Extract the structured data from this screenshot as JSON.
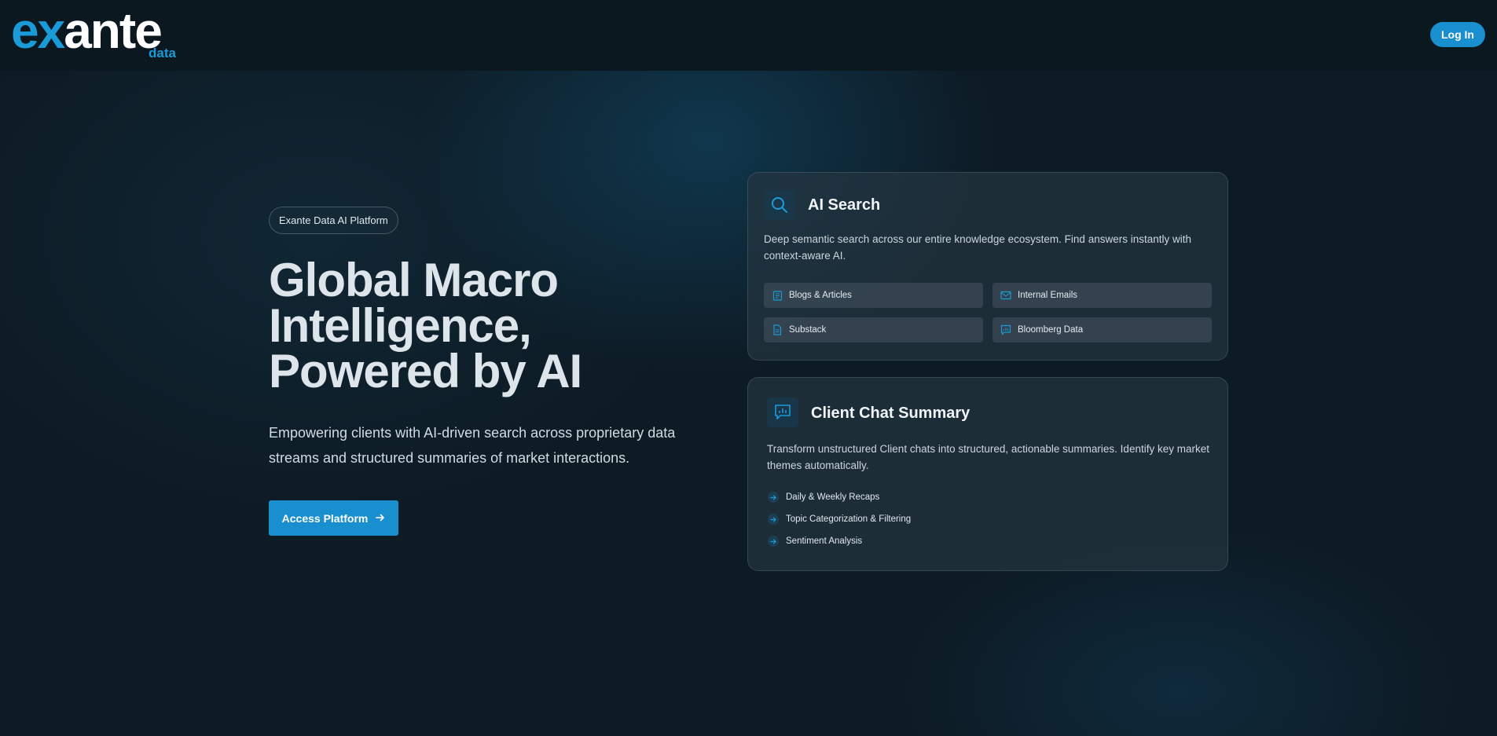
{
  "header": {
    "logo_main_a": "ex",
    "logo_main_b": "ante",
    "logo_sub": "data",
    "login_label": "Log In"
  },
  "hero": {
    "badge": "Exante Data AI Platform",
    "title_lines": [
      "Global Macro",
      "Intelligence,",
      "Powered by AI"
    ],
    "description": "Empowering clients with AI-driven search across proprietary data streams and structured summaries of market interactions.",
    "cta_label": "Access Platform",
    "cta_icon": "arrow-right-icon"
  },
  "ai_search": {
    "icon": "search-icon",
    "title": "AI Search",
    "description": "Deep semantic search across our entire knowledge ecosystem. Find answers instantly with context-aware AI.",
    "sources": [
      {
        "label": "Blogs & Articles",
        "icon": "article-icon"
      },
      {
        "label": "Internal Emails",
        "icon": "mail-icon"
      },
      {
        "label": "Substack",
        "icon": "document-icon"
      },
      {
        "label": "Bloomberg Data",
        "icon": "chart-message-icon"
      }
    ]
  },
  "client_chat": {
    "icon": "chat-chart-icon",
    "title": "Client Chat Summary",
    "description": "Transform unstructured Client chats into structured, actionable summaries. Identify key market themes automatically.",
    "features": [
      {
        "label": "Daily & Weekly Recaps"
      },
      {
        "label": "Topic Categorization & Filtering"
      },
      {
        "label": "Sentiment Analysis"
      }
    ]
  },
  "colors": {
    "accent": "#1a8fd0",
    "logo_blue": "#1a9bd7",
    "background": "#0d1b25"
  }
}
